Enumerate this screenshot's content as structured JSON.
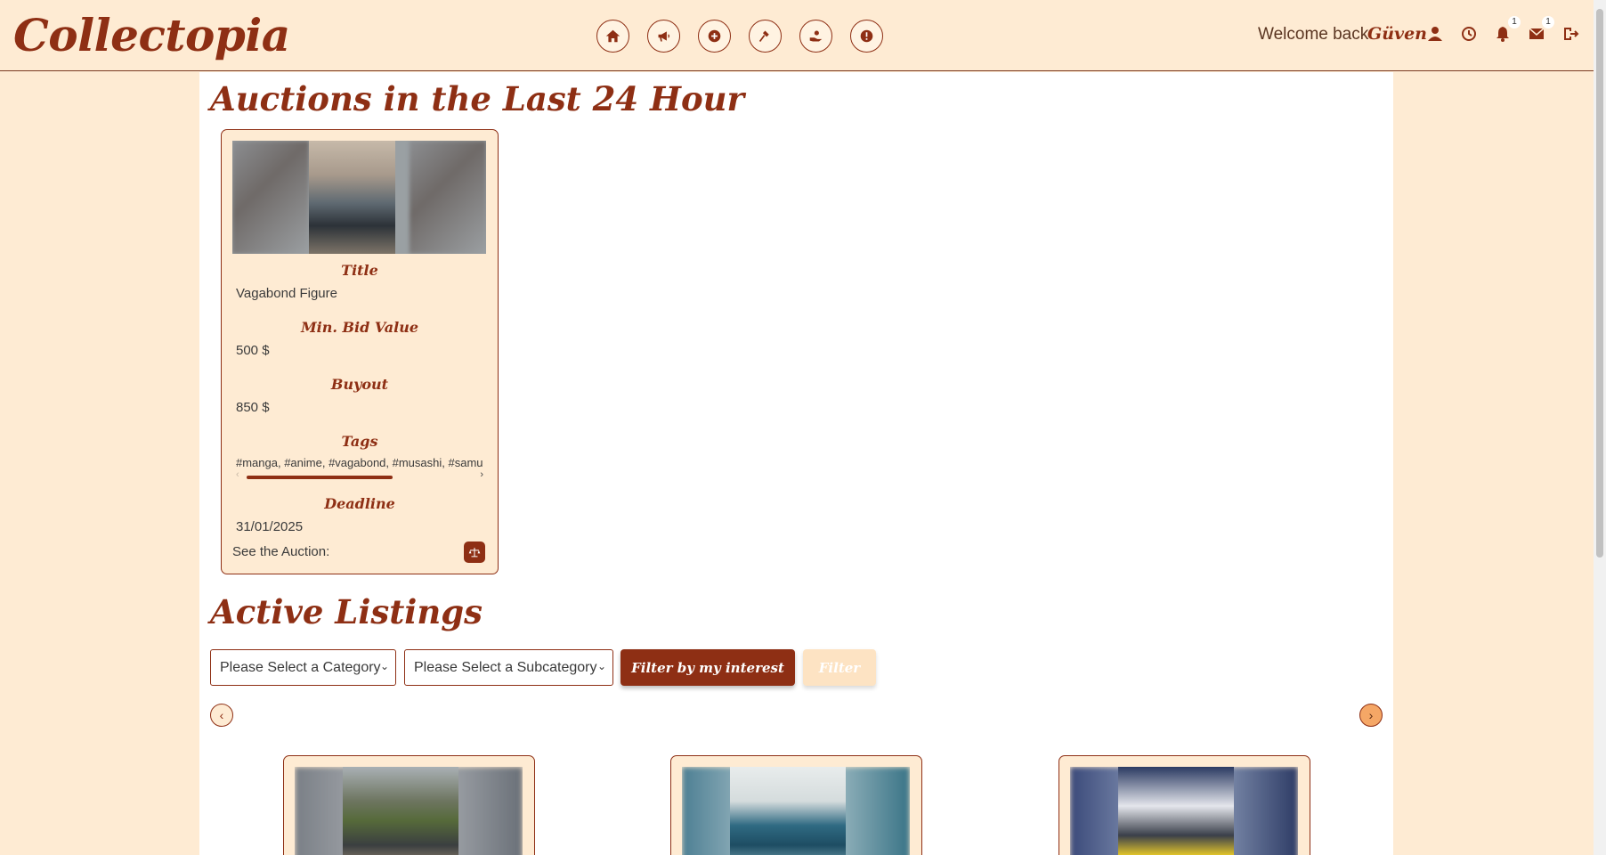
{
  "brand": "Collectopia",
  "nav": [
    {
      "icon": "home-icon"
    },
    {
      "icon": "megaphone-icon"
    },
    {
      "icon": "add-icon"
    },
    {
      "icon": "gavel-icon"
    },
    {
      "icon": "donate-icon"
    },
    {
      "icon": "info-icon"
    }
  ],
  "user": {
    "welcome": "Welcome back",
    "name": "Güven",
    "notifications_count": "1",
    "messages_count": "1"
  },
  "auctions": {
    "section_title": "Auctions in the Last 24 Hour",
    "card": {
      "title_label": "Title",
      "title_value": "Vagabond Figure",
      "min_bid_label": "Min. Bid Value",
      "min_bid_value": "500 $",
      "buyout_label": "Buyout",
      "buyout_value": "850 $",
      "tags_label": "Tags",
      "tags_value": "#manga, #anime, #vagabond, #musashi, #samurai",
      "deadline_label": "Deadline",
      "deadline_value": "31/01/2025",
      "see_label": "See the Auction:"
    }
  },
  "listings": {
    "section_title": "Active Listings",
    "category_placeholder": "Please Select a Category",
    "subcategory_placeholder": "Please Select a Subcategory",
    "interest_button": "Filter by my interest",
    "filter_button": "Filter",
    "prev_arrow": "‹",
    "next_arrow": "›"
  },
  "colors": {
    "brand": "#8e2f14",
    "background": "#feebd3",
    "accent_orange": "#f5a766"
  }
}
